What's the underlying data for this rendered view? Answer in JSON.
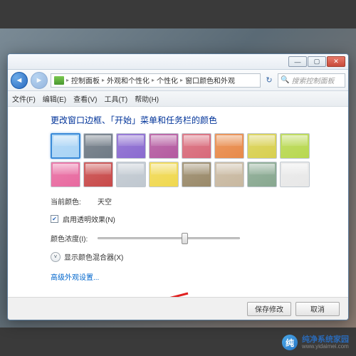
{
  "breadcrumb": {
    "root": "控制面板",
    "level1": "外观和个性化",
    "level2": "个性化",
    "current": "窗口颜色和外观"
  },
  "search": {
    "placeholder": "搜索控制面板"
  },
  "menu": {
    "file": "文件(F)",
    "edit": "编辑(E)",
    "view": "查看(V)",
    "tools": "工具(T)",
    "help": "帮助(H)"
  },
  "heading": "更改窗口边框、「开始」菜单和任务栏的颜色",
  "colors": [
    {
      "hex": "#aad4f5",
      "selected": true
    },
    {
      "hex": "#6f7a85"
    },
    {
      "hex": "#8a6ad0"
    },
    {
      "hex": "#b45aa0"
    },
    {
      "hex": "#d86a7a"
    },
    {
      "hex": "#e88a4a"
    },
    {
      "hex": "#d8d050"
    },
    {
      "hex": "#b8d850"
    },
    {
      "hex": "#e86aa0"
    },
    {
      "hex": "#c84a4a"
    },
    {
      "hex": "#c0c8d0"
    },
    {
      "hex": "#f0d850"
    },
    {
      "hex": "#9a8a6a"
    },
    {
      "hex": "#c8b8a0"
    },
    {
      "hex": "#88a890"
    },
    {
      "hex": "#e8e8e8"
    }
  ],
  "current_color": {
    "label": "当前颜色:",
    "value": "天空"
  },
  "transparency": {
    "label": "启用透明效果(N)",
    "checked": true
  },
  "intensity": {
    "label": "颜色浓度(I):",
    "value": 60
  },
  "mixer": {
    "label": "显示颜色混合器(X)"
  },
  "advanced_link": "高级外观设置...",
  "footer": {
    "save": "保存修改",
    "cancel": "取消"
  },
  "watermark": {
    "name": "纯净系统家园",
    "url": "www.yidaimei.com"
  }
}
